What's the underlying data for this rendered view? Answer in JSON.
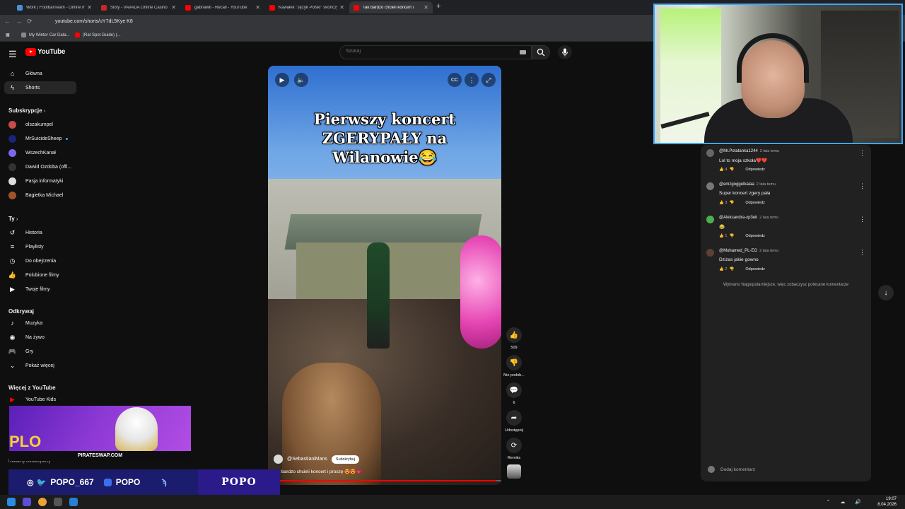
{
  "browser": {
    "tabs": [
      {
        "title": "Work | FootballTeam - Online m",
        "color": "#4a90d9"
      },
      {
        "title": "Sloty - VAVADA Online Casino",
        "color": "#c62828"
      },
      {
        "title": "gabriawll - Recall - YouTube",
        "color": "#ff0000"
      },
      {
        "title": "Kawałek \"Język Polski\" skończył",
        "color": "#ff0000"
      },
      {
        "title": "Tak bardzo chcieli koncert i",
        "color": "#ff0000"
      }
    ],
    "new_tab": "+",
    "url": "youtube.com/shorts/uY7dL5Kye K8",
    "bookmarks": [
      "My Winter Car Data...",
      "(Rat Spot Guide) (..."
    ]
  },
  "header": {
    "logo_text": "YouTube",
    "search_placeholder": "Szukaj"
  },
  "sidebar": {
    "main": [
      {
        "label": "Główna",
        "icon": "home-icon"
      },
      {
        "label": "Shorts",
        "icon": "shorts-icon",
        "active": true
      }
    ],
    "subs_heading": "Subskrypcje",
    "subs": [
      {
        "label": "olszakumpel",
        "color": "#c94b4b"
      },
      {
        "label": "MrSuicideSheep",
        "color": "#1a237e",
        "live": true
      },
      {
        "label": "WszechKanał",
        "color": "#7b68ee"
      },
      {
        "label": "Dawid Ozdoba (offi...",
        "color": "#333"
      },
      {
        "label": "Pasja informatyki",
        "color": "#ddd"
      },
      {
        "label": "Bagietka Michael",
        "color": "#a0522d"
      }
    ],
    "you_heading": "Ty",
    "you": [
      {
        "label": "Historia",
        "icon": "history-icon"
      },
      {
        "label": "Playlisty",
        "icon": "playlist-icon"
      },
      {
        "label": "Do obejrzenia",
        "icon": "watch-later-icon"
      },
      {
        "label": "Polubione filmy",
        "icon": "like-icon"
      },
      {
        "label": "Twoje filmy",
        "icon": "your-videos-icon"
      }
    ],
    "explore_heading": "Odkrywaj",
    "explore": [
      {
        "label": "Muzyka",
        "icon": "music-icon"
      },
      {
        "label": "Na żywo",
        "icon": "live-icon"
      },
      {
        "label": "Gry",
        "icon": "gaming-icon"
      },
      {
        "label": "Pokaż więcej",
        "icon": "chevron-down-icon"
      }
    ],
    "more_heading": "Więcej z YouTube",
    "more": [
      {
        "label": "YouTube Kids",
        "icon": "youtube-kids-icon"
      }
    ],
    "footer": "Reklamy  Deweloperzy"
  },
  "video": {
    "title_lines": [
      "Pierwszy koncert",
      "ZGERYPAŁY na",
      "Wilanowie😂"
    ],
    "channel": "@SebastianiMans",
    "subscribe": "Subskrybuj",
    "description": "k bardzo chcieli koncert i proszę 😍😍💗",
    "progress": 0.98
  },
  "actions": {
    "likes": "509",
    "dislike": "Nie podob...",
    "comments": "6",
    "share": "Udostępnij",
    "remix": "Remiks"
  },
  "comments": {
    "items": [
      {
        "user": "@Mr.Potatanka1244",
        "time": "2 lata temu",
        "text": "Lol to moja szkoła❤️❤️",
        "likes": "4",
        "reply": "Odpowiedz",
        "color": "#666"
      },
      {
        "user": "@emzgoggelkalaa",
        "time": "2 lata temu",
        "text": "Super koncert zgery pała",
        "likes": "3",
        "reply": "Odpowiedz",
        "color": "#777"
      },
      {
        "user": "@Aleksandra-xp3ek",
        "time": "2 lata temu",
        "text": "😂",
        "likes": "1",
        "reply": "Odpowiedz",
        "color": "#4caf50"
      },
      {
        "user": "@Mohamed_PL-EG",
        "time": "2 lata temu",
        "text": "Dzizas jakie gowno",
        "likes": "2",
        "reply": "Odpowiedz",
        "color": "#5d4037"
      }
    ],
    "sort_note": "Wybrano Najpopularniejsze, więc zobaczysz polecane komentarze",
    "add_placeholder": "Dodaj komentarz"
  },
  "overlay": {
    "promo_site": "PIRATESWAP.COM",
    "promo_big": "PLO",
    "social_handle": "POPO_667",
    "youtube_handle": "POPO",
    "brand": "POPO"
  },
  "taskbar": {
    "time": "19:07",
    "date": "8.04.2026"
  }
}
